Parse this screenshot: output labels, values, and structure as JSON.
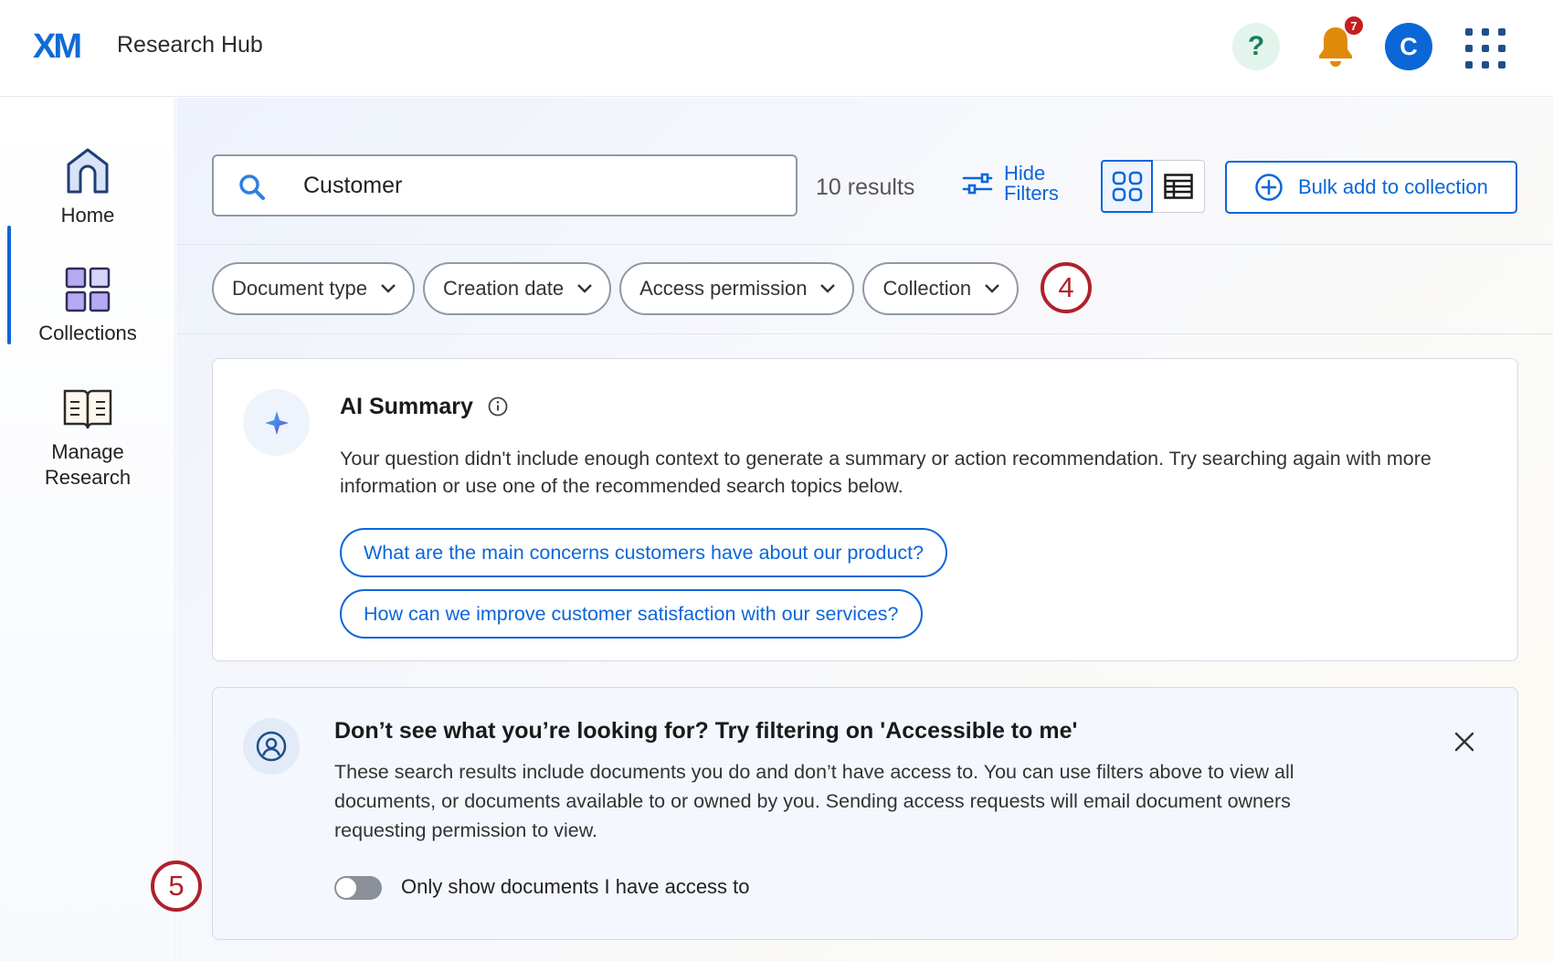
{
  "header": {
    "logo_text": "XM",
    "app_title": "Research Hub",
    "help_icon": "?",
    "notification_count": "7",
    "avatar_initial": "C"
  },
  "sidebar": {
    "items": [
      {
        "label": "Home",
        "icon": "home-icon",
        "active": true
      },
      {
        "label": "Collections",
        "icon": "collections-icon",
        "active": false
      },
      {
        "label": "Manage Research",
        "icon": "book-icon",
        "active": false
      }
    ]
  },
  "search": {
    "value": "Customer",
    "results_text": "10 results",
    "hide_filters_label_line1": "Hide",
    "hide_filters_label_line2": "Filters",
    "bulk_add_label": "Bulk add to collection"
  },
  "filters": {
    "chips": [
      "Document type",
      "Creation date",
      "Access permission",
      "Collection"
    ],
    "marker": "4"
  },
  "ai_summary": {
    "title": "AI Summary",
    "text": "Your question didn't include enough context to generate a summary or action recommendation. Try searching again with more information or use one of the recommended search topics below.",
    "suggestions": [
      "What are the main concerns customers have about our product?",
      "How can we improve customer satisfaction with our services?"
    ]
  },
  "access_notice": {
    "title": "Don’t see what you’re looking for? Try filtering on 'Accessible to me'",
    "text": "These search results include documents you do and don’t have access to. You can use filters above to view all documents, or documents available to or owned by you. Sending access requests will email document owners requesting permission to view.",
    "toggle_label": "Only show documents I have access to",
    "toggle_on": false,
    "marker": "5"
  },
  "colors": {
    "accent": "#0b66d8",
    "marker": "#b0202b",
    "badge": "#c41e1e"
  }
}
